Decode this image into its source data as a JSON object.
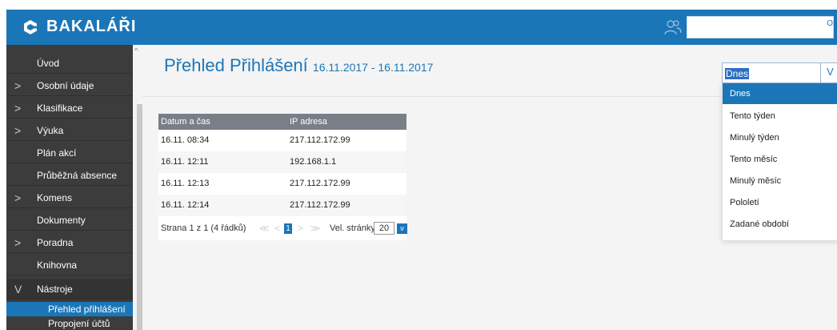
{
  "header": {
    "app_name": "BAKALÁŘI",
    "user_box_edge": "O",
    "brand_color": "#1b76b8"
  },
  "sidebar": {
    "items": [
      {
        "label": "Úvod",
        "arrow": ""
      },
      {
        "label": "Osobní údaje",
        "arrow": ">"
      },
      {
        "label": "Klasifikace",
        "arrow": ">"
      },
      {
        "label": "Výuka",
        "arrow": ">"
      },
      {
        "label": "Plán akcí",
        "arrow": ""
      },
      {
        "label": "Průběžná absence",
        "arrow": ""
      },
      {
        "label": "Komens",
        "arrow": ">"
      },
      {
        "label": "Dokumenty",
        "arrow": ""
      },
      {
        "label": "Poradna",
        "arrow": ">"
      },
      {
        "label": "Knihovna",
        "arrow": ""
      },
      {
        "label": "Nástroje",
        "arrow": "V"
      }
    ],
    "subitems": [
      {
        "label": "Přehled přihlášení",
        "active": true
      },
      {
        "label": "Propojení účtů",
        "active": false
      }
    ]
  },
  "page": {
    "title": "Přehled Přihlášení",
    "date_range": "16.11.2017 - 16.11.2017"
  },
  "table": {
    "columns": [
      "Datum a čas",
      "IP adresa"
    ],
    "rows": [
      [
        "16.11. 08:34",
        "217.112.172.99"
      ],
      [
        "16.11. 12:11",
        "192.168.1.1"
      ],
      [
        "16.11. 12:13",
        "217.112.172.99"
      ],
      [
        "16.11. 12:14",
        "217.112.172.99"
      ]
    ]
  },
  "pager": {
    "summary": "Strana 1 z 1 (4 řádků)",
    "first": "≪",
    "prev": "<",
    "current_page": "1",
    "next": ">",
    "last": "≫",
    "page_size_label": "Vel. stránky",
    "page_size": "20",
    "page_size_arrow": "v"
  },
  "period_select": {
    "value": "Dnes",
    "arrow": "V",
    "options": [
      "Dnes",
      "Tento týden",
      "Minulý týden",
      "Tento měsíc",
      "Minulý měsíc",
      "Pololetí",
      "Zadané období"
    ],
    "selected_index": 0
  }
}
